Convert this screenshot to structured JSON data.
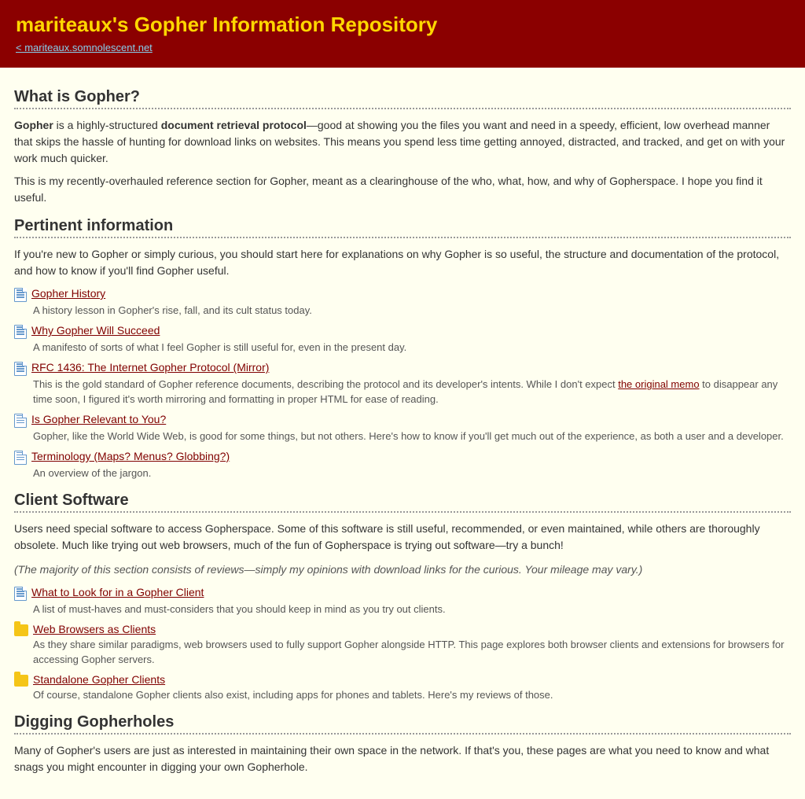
{
  "header": {
    "title": "mariteaux's Gopher Information Repository",
    "back_link": "< mariteaux.somnolescent.net"
  },
  "sections": [
    {
      "id": "what-is-gopher",
      "heading": "What is Gopher?",
      "paragraphs": [
        {
          "parts": [
            {
              "type": "bold",
              "text": "Gopher"
            },
            {
              "type": "text",
              "text": " is a highly-structured "
            },
            {
              "type": "bold",
              "text": "document retrieval protocol"
            },
            {
              "type": "text",
              "text": "—good at showing you the files you want and need in a speedy, efficient, low overhead manner that skips the hassle of hunting for download links on websites. This means you spend less time getting annoyed, distracted, and tracked, and get on with your work much quicker."
            }
          ]
        },
        {
          "parts": [
            {
              "type": "text",
              "text": "This is my recently-overhauled reference section for Gopher, meant as a clearinghouse of the who, what, how, and why of Gopherspace. I hope you find it useful."
            }
          ]
        }
      ]
    },
    {
      "id": "pertinent-information",
      "heading": "Pertinent information",
      "intro": "If you're new to Gopher or simply curious, you should start here for explanations on why Gopher is so useful, the structure and documentation of the protocol, and how to know if you'll find Gopher useful.",
      "items": [
        {
          "icon": "doc",
          "link": "Gopher History",
          "desc": "A history lesson in Gopher's rise, fall, and its cult status today."
        },
        {
          "icon": "doc",
          "link": "Why Gopher Will Succeed",
          "desc": "A manifesto of sorts of what I feel Gopher is still useful for, even in the present day."
        },
        {
          "icon": "doc",
          "link": "RFC 1436: The Internet Gopher Protocol (Mirror)",
          "desc_parts": [
            {
              "type": "text",
              "text": "This is the gold standard of Gopher reference documents, describing the protocol and its developer's intents. While I don't expect "
            },
            {
              "type": "underline",
              "text": "the original memo"
            },
            {
              "type": "text",
              "text": " to disappear any time soon, I figured it's worth mirroring and formatting in proper HTML for ease of reading."
            }
          ]
        },
        {
          "icon": "doc",
          "link": "Is Gopher Relevant to You?",
          "desc": "Gopher, like the World Wide Web, is good for some things, but not others. Here's how to know if you'll get much out of the experience, as both a user and a developer."
        },
        {
          "icon": "doc",
          "link": "Terminology (Maps? Menus? Globbing?)",
          "desc": "An overview of the jargon."
        }
      ]
    },
    {
      "id": "client-software",
      "heading": "Client Software",
      "intro": "Users need special software to access Gopherspace. Some of this software is still useful, recommended, or even maintained, while others are thoroughly obsolete. Much like trying out web browsers, much of the fun of Gopherspace is trying out software—try a bunch!",
      "note": "(The majority of this section consists of reviews—simply my opinions with download links for the curious. Your mileage may vary.)",
      "items": [
        {
          "icon": "doc",
          "link": "What to Look for in a Gopher Client",
          "desc": "A list of must-haves and must-considers that you should keep in mind as you try out clients."
        },
        {
          "icon": "folder",
          "link": "Web Browsers as Clients",
          "desc": "As they share similar paradigms, web browsers used to fully support Gopher alongside HTTP. This page explores both browser clients and extensions for browsers for accessing Gopher servers."
        },
        {
          "icon": "folder",
          "link": "Standalone Gopher Clients",
          "desc": "Of course, standalone Gopher clients also exist, including apps for phones and tablets. Here's my reviews of those."
        }
      ]
    },
    {
      "id": "digging-gopherholes",
      "heading": "Digging Gopherholes",
      "intro": "Many of Gopher's users are just as interested in maintaining their own space in the network. If that's you, these pages are what you need to know and what snags you might encounter in digging your own Gopherhole."
    }
  ]
}
